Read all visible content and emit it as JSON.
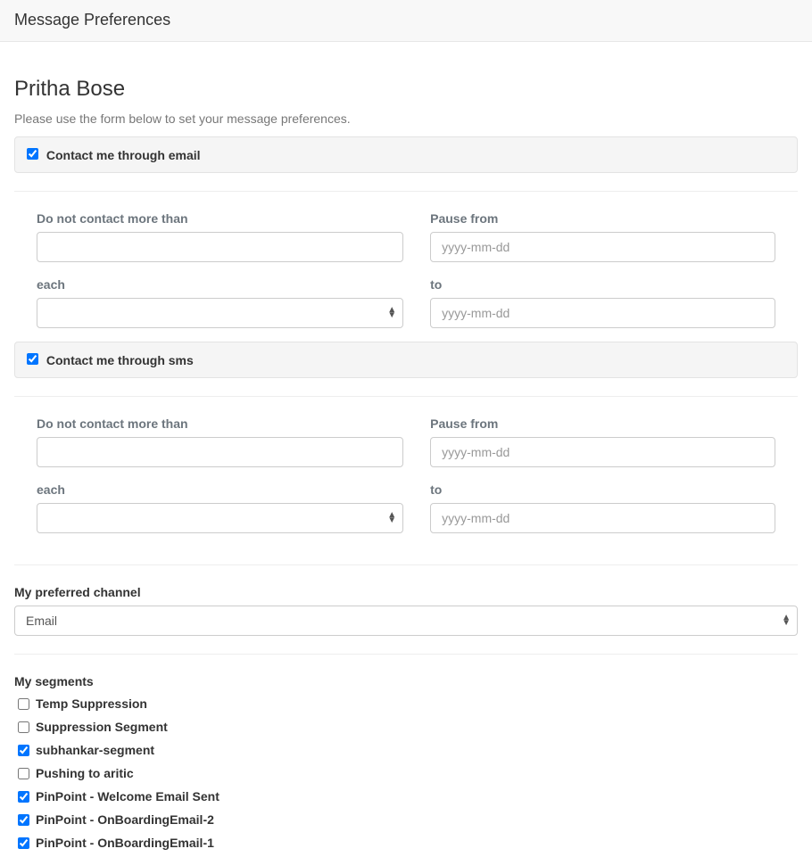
{
  "navbar": {
    "title": "Message Preferences"
  },
  "user": {
    "name": "Pritha Bose"
  },
  "instructions": "Please use the form below to set your message preferences.",
  "channels": [
    {
      "key": "email",
      "label": "Contact me through email",
      "checked": true,
      "frequency_label": "Do not contact more than",
      "frequency_value": "",
      "each_label": "each",
      "each_value": "",
      "pause_from_label": "Pause from",
      "pause_from_value": "",
      "pause_from_placeholder": "yyyy-mm-dd",
      "to_label": "to",
      "to_value": "",
      "to_placeholder": "yyyy-mm-dd"
    },
    {
      "key": "sms",
      "label": "Contact me through sms",
      "checked": true,
      "frequency_label": "Do not contact more than",
      "frequency_value": "",
      "each_label": "each",
      "each_value": "",
      "pause_from_label": "Pause from",
      "pause_from_value": "",
      "pause_from_placeholder": "yyyy-mm-dd",
      "to_label": "to",
      "to_value": "",
      "to_placeholder": "yyyy-mm-dd"
    }
  ],
  "preferred_channel": {
    "label": "My preferred channel",
    "value": "Email"
  },
  "segments": {
    "label": "My segments",
    "items": [
      {
        "label": "Temp Suppression",
        "checked": false
      },
      {
        "label": "Suppression Segment",
        "checked": false
      },
      {
        "label": "subhankar-segment",
        "checked": true
      },
      {
        "label": "Pushing to aritic",
        "checked": false
      },
      {
        "label": "PinPoint - Welcome Email Sent",
        "checked": true
      },
      {
        "label": "PinPoint - OnBoardingEmail-2",
        "checked": true
      },
      {
        "label": "PinPoint - OnBoardingEmail-1",
        "checked": true
      }
    ]
  }
}
